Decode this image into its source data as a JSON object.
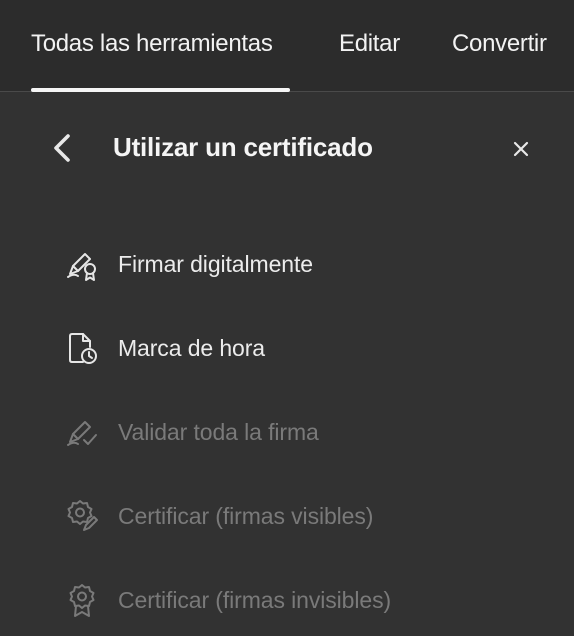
{
  "tabs": [
    {
      "label": "Todas las herramientas",
      "active": true
    },
    {
      "label": "Editar",
      "active": false
    },
    {
      "label": "Convertir",
      "active": false
    }
  ],
  "panel": {
    "title": "Utilizar un certificado",
    "back_icon": "chevron-left-icon",
    "close_icon": "close-icon"
  },
  "menu": {
    "items": [
      {
        "label": "Firmar digitalmente",
        "icon": "sign-certificate-icon",
        "enabled": true
      },
      {
        "label": "Marca de hora",
        "icon": "document-clock-icon",
        "enabled": true
      },
      {
        "label": "Validar toda la firma",
        "icon": "pen-check-icon",
        "enabled": false
      },
      {
        "label": "Certificar (firmas visibles)",
        "icon": "badge-pen-icon",
        "enabled": false
      },
      {
        "label": "Certificar (firmas invisibles)",
        "icon": "ribbon-badge-icon",
        "enabled": false
      }
    ]
  },
  "colors": {
    "background": "#323232",
    "topbar": "#2c2c2c",
    "text": "#f0f0f0",
    "disabled_text": "#7a7a7a"
  }
}
